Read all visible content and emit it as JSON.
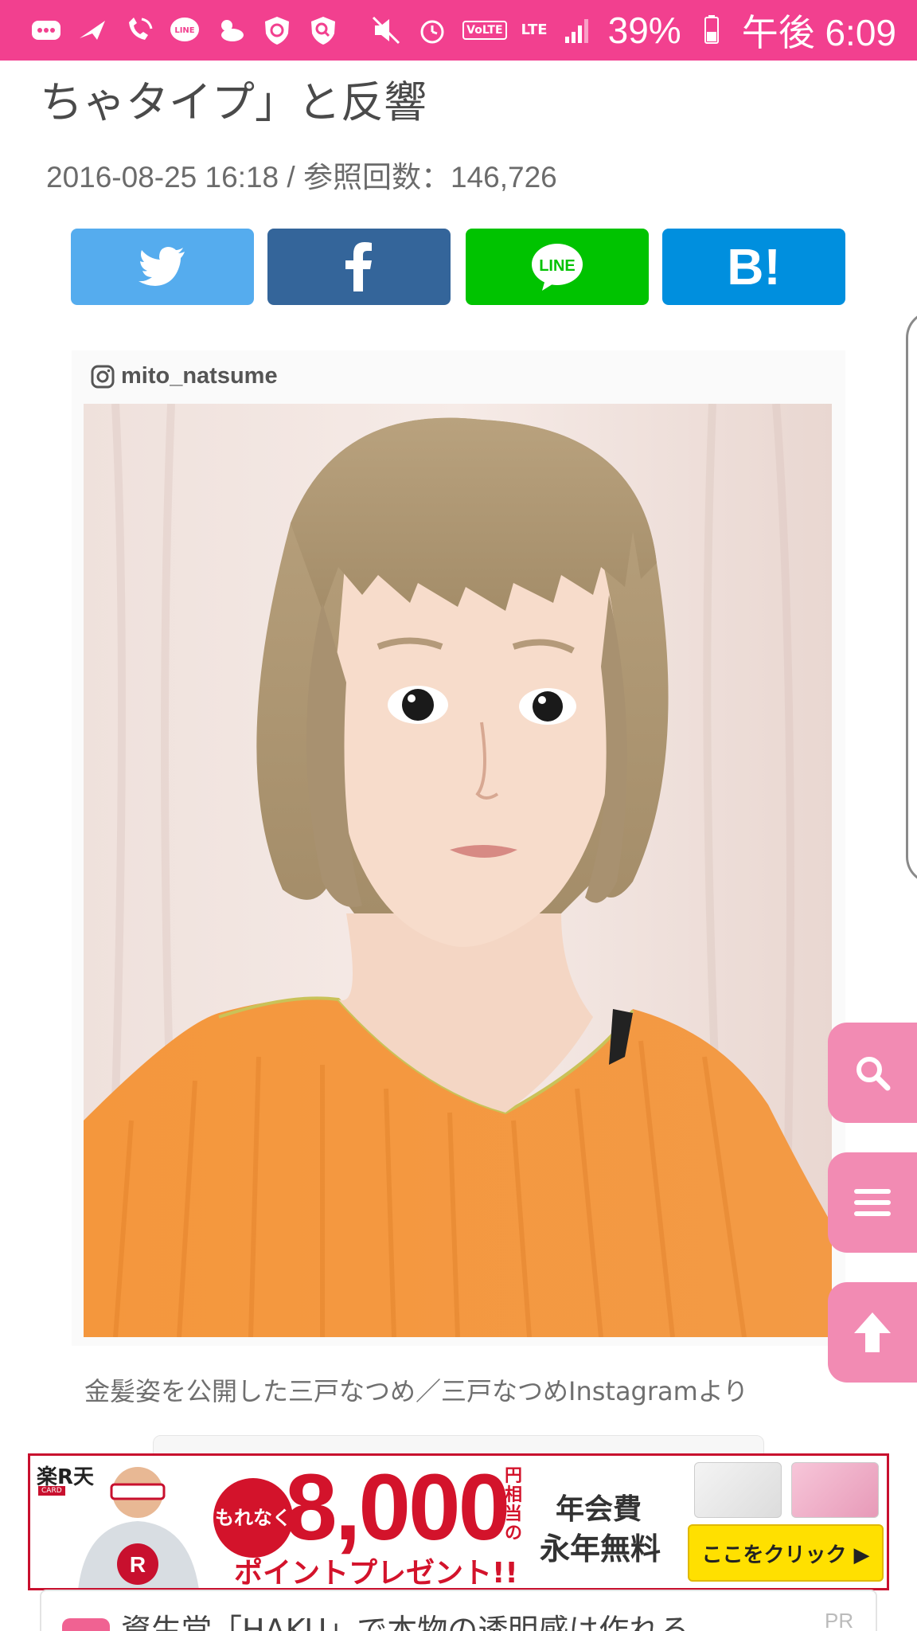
{
  "status_bar": {
    "battery": "39%",
    "time": "午後 6:09",
    "network": "LTE",
    "volte": "VoLTE",
    "line_icon_text": "LINE",
    "left_icons": [
      "message-icon",
      "send-icon",
      "wifi-call-icon",
      "line-icon",
      "weather-icon",
      "shield-icon",
      "shield-search-icon"
    ],
    "right_icons": [
      "mute-icon",
      "alarm-icon",
      "volte-icon",
      "lte-icon",
      "signal-icon",
      "battery-icon"
    ]
  },
  "article": {
    "headline": "ちゃタイプ」と反響",
    "meta": "2016-08-25 16:18 / 参照回数：146,726",
    "photo_credit": "mito_natsume",
    "caption": "金髪姿を公開した三戸なつめ／三戸なつめInstagramより"
  },
  "share": {
    "twitter": "twitter-icon",
    "facebook": "facebook-icon",
    "line": "LINE",
    "hatena": "B!"
  },
  "fab": {
    "search": "search-icon",
    "menu": "menu-icon",
    "top": "arrow-up-icon"
  },
  "ad": {
    "brand": "楽R天",
    "card": "CARD",
    "motenaku": "もれなく",
    "amount": "8,000",
    "yen_label": "円相当の",
    "point_text": "ポイントプレゼント!!",
    "fee_line1": "年会費",
    "fee_line2": "永年無料",
    "cta": "ここをクリック ▶"
  },
  "next_article": {
    "title": "資生堂「HAKU」で本物の透明感は作れる",
    "badge": "PR"
  },
  "colors": {
    "status_bar": "#f2408f",
    "twitter": "#55acee",
    "facebook": "#34659a",
    "line": "#00c300",
    "hatena": "#008fde",
    "fab": "#f28bb3",
    "ad_red": "#d3132b"
  }
}
